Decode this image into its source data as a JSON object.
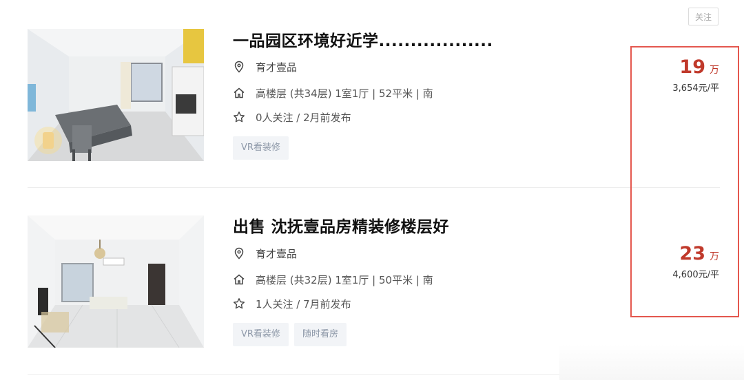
{
  "follow_button": "关注",
  "listings": [
    {
      "title": "一品园区环境好近学..................",
      "community": "育才壹品",
      "info": "高楼层 (共34层) 1室1厅 | 52平米 | 南",
      "follow_info": "0人关注 / 2月前发布",
      "tags": [
        "VR看装修"
      ],
      "total_price": "19",
      "total_unit": "万",
      "unit_price": "3,654元/平"
    },
    {
      "title": "出售 沈抚壹品房精装修楼层好",
      "community": "育才壹品",
      "info": "高楼层 (共32层) 1室1厅 | 50平米 | 南",
      "follow_info": "1人关注 / 7月前发布",
      "tags": [
        "VR看装修",
        "随时看房"
      ],
      "total_price": "23",
      "total_unit": "万",
      "unit_price": "4,600元/平"
    }
  ],
  "colors": {
    "price": "#c0392b",
    "highlight": "#e4574e",
    "tag_bg": "#f2f4f7",
    "tag_text": "#8d98a8"
  },
  "icons": {
    "location": "location-pin-icon",
    "house": "house-icon",
    "follow": "star-icon"
  }
}
